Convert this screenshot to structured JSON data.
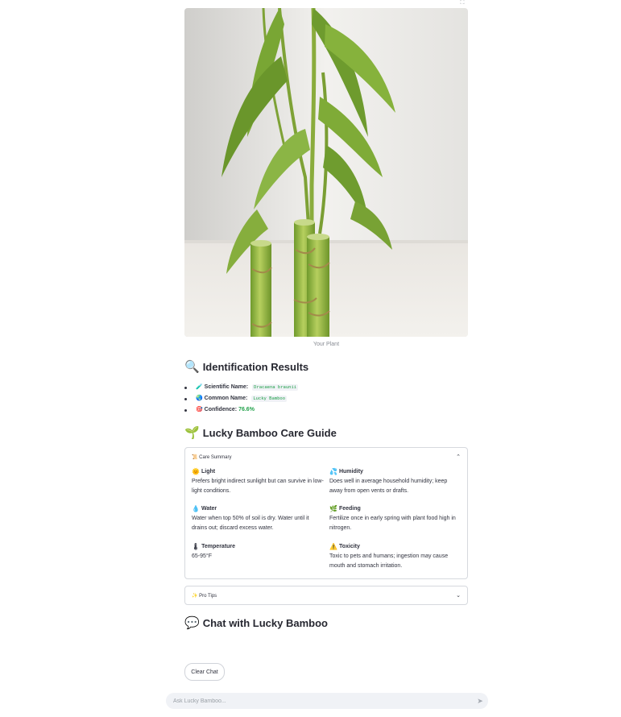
{
  "image": {
    "caption": "Your Plant"
  },
  "identification": {
    "title": "Identification Results",
    "scientific_label": "Scientific Name:",
    "scientific_value": "Dracaena braunii",
    "common_label": "Common Name:",
    "common_value": "Lucky Bamboo",
    "confidence_label": "Confidence:",
    "confidence_value": "76.6%"
  },
  "care_guide": {
    "title": "Lucky Bamboo Care Guide",
    "summary_label": "Care Summary",
    "summary_expanded": true,
    "items": [
      {
        "title": "Light",
        "icon": "sun-icon",
        "text": "Prefers bright indirect sunlight but can survive in low-light conditions."
      },
      {
        "title": "Humidity",
        "icon": "humidity-icon",
        "text": "Does well in average household humidity; keep away from open vents or drafts."
      },
      {
        "title": "Water",
        "icon": "water-drop-icon",
        "text": "Water when top 50% of soil is dry. Water until it drains out; discard excess water."
      },
      {
        "title": "Feeding",
        "icon": "plant-food-icon",
        "text": "Fertilize once in early spring with plant food high in nitrogen."
      },
      {
        "title": "Temperature",
        "icon": "thermometer-icon",
        "text": "65-95°F"
      },
      {
        "title": "Toxicity",
        "icon": "warning-icon",
        "text": "Toxic to pets and humans; ingestion may cause mouth and stomach irritation."
      }
    ],
    "pro_tips_label": "Pro Tips",
    "pro_tips_expanded": false
  },
  "chat": {
    "title": "Chat with Lucky Bamboo",
    "clear_label": "Clear Chat",
    "input_placeholder": "Ask Lucky Bamboo..."
  },
  "colors": {
    "accent_green": "#21a14a",
    "border": "#d6d9de",
    "input_bg": "#f0f2f6"
  }
}
